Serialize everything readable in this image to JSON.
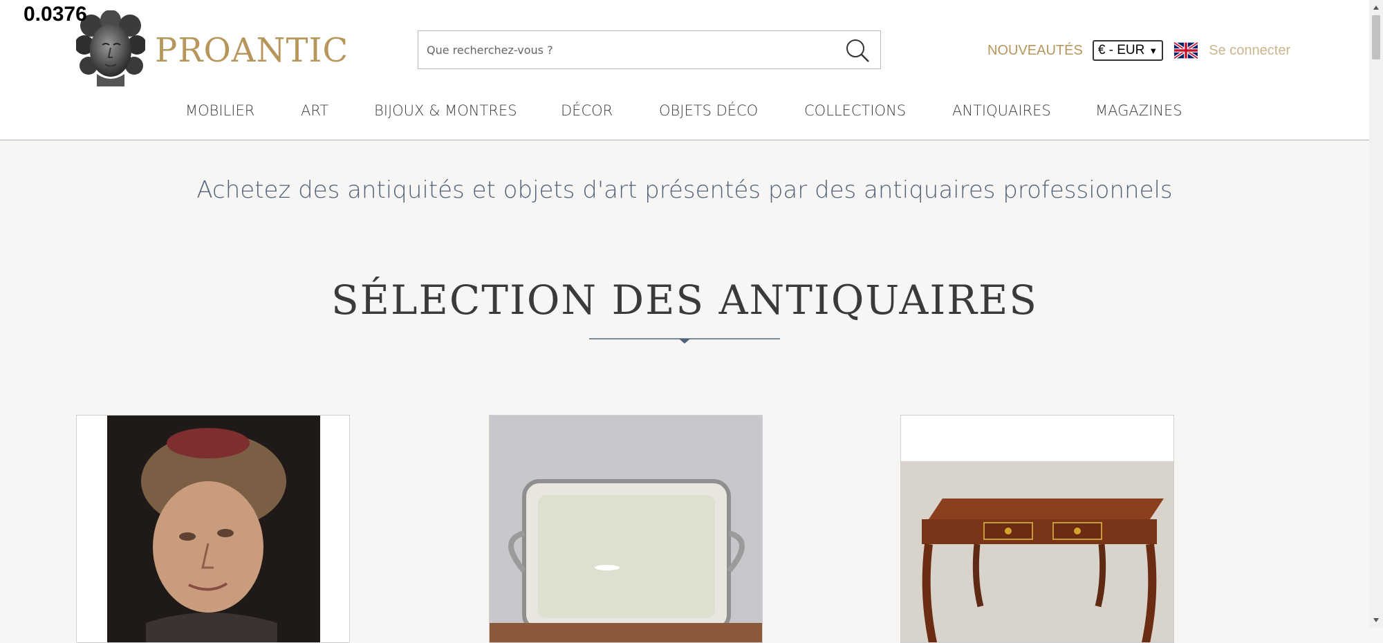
{
  "overlay": {
    "value": "0.0376"
  },
  "header": {
    "brand": "PROANTIC",
    "search": {
      "placeholder": "Que recherchez-vous ?",
      "value": ""
    },
    "nouveautes": "NOUVEAUTÉS",
    "currency": "€ - EUR",
    "login": "Se connecter",
    "colors": {
      "brand": "#b7965b",
      "accent": "#51637a"
    }
  },
  "nav": {
    "items": [
      "MOBILIER",
      "ART",
      "BIJOUX & MONTRES",
      "DÉCOR",
      "OBJETS DÉCO",
      "COLLECTIONS",
      "ANTIQUAIRES",
      "MAGAZINES"
    ]
  },
  "main": {
    "tagline": "Achetez des antiquités et objets d'art présentés par des antiquaires professionnels",
    "section_title": "SÉLECTION DES ANTIQUAIRES",
    "cards": [
      {
        "image": "portrait-painting"
      },
      {
        "image": "silver-tray"
      },
      {
        "image": "marquetry-desk"
      }
    ]
  }
}
